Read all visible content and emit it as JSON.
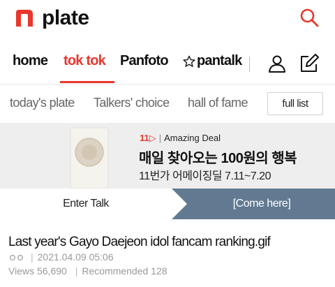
{
  "header": {
    "logo_text": "plate",
    "brand_color": "#e8372d"
  },
  "nav": {
    "items": [
      {
        "label": "home"
      },
      {
        "label": "tok tok",
        "active": true
      },
      {
        "label": "Panfoto"
      },
      {
        "label": "pantalk",
        "icon": "star-outline-icon"
      }
    ],
    "icons": [
      "user-icon",
      "write-icon",
      "search-icon"
    ]
  },
  "subtabs": {
    "items": [
      "today's plate",
      "Talkers' choice",
      "hall of fame"
    ],
    "full_list": "full list"
  },
  "banner": {
    "brand_mark": "11",
    "brand_name": "Amazing Deal",
    "headline": "매일 찾아오는 100원의 행복",
    "subline": "11번가 어메이징딜 7.11~7.20"
  },
  "split": {
    "left": "Enter Talk",
    "right": "[Come here]",
    "right_color": "#617a91"
  },
  "post": {
    "title": "Last year's Gayo Daejeon idol fancam ranking.gif",
    "date": "2021.04.09 05:06",
    "views_label": "Views",
    "views": "56,690",
    "recommended_label": "Recommended",
    "recommended": "128"
  }
}
